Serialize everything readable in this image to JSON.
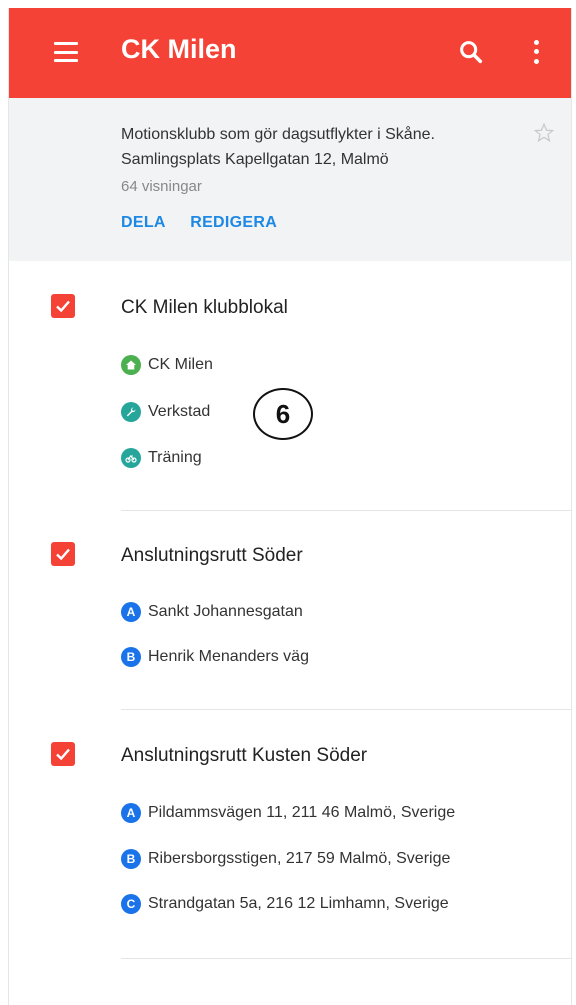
{
  "appbar": {
    "title": "CK Milen",
    "color": "#f44336"
  },
  "info": {
    "description_line1": "Motionsklubb som gör dagsutflykter i Skåne.",
    "description_line2": "Samlingsplats Kapellgatan 12, Malmö",
    "views": "64 visningar",
    "share_label": "DELA",
    "edit_label": "REDIGERA"
  },
  "layers": [
    {
      "name": "CK Milen klubblokal",
      "checked": true,
      "items": [
        {
          "label": "CK Milen",
          "icon": "home-icon",
          "color": "#4caf50"
        },
        {
          "label": "Verkstad",
          "icon": "wrench-icon",
          "color": "#26a69a"
        },
        {
          "label": "Träning",
          "icon": "bike-icon",
          "color": "#26a69a"
        }
      ]
    },
    {
      "name": "Anslutningsrutt Söder",
      "checked": true,
      "items": [
        {
          "label": "Sankt Johannesgatan",
          "marker": "A",
          "color": "#1a73e8"
        },
        {
          "label": "Henrik Menanders väg",
          "marker": "B",
          "color": "#1a73e8"
        }
      ]
    },
    {
      "name": "Anslutningsrutt Kusten Söder",
      "checked": true,
      "items": [
        {
          "label": "Pildammsvägen 11, 211 46 Malmö, Sverige",
          "marker": "A",
          "color": "#1a73e8"
        },
        {
          "label": "Ribersborgsstigen, 217 59 Malmö, Sverige",
          "marker": "B",
          "color": "#1a73e8"
        },
        {
          "label": "Strandgatan 5a, 216 12 Limhamn, Sverige",
          "marker": "C",
          "color": "#1a73e8"
        }
      ]
    }
  ],
  "annotation": {
    "label": "6"
  }
}
